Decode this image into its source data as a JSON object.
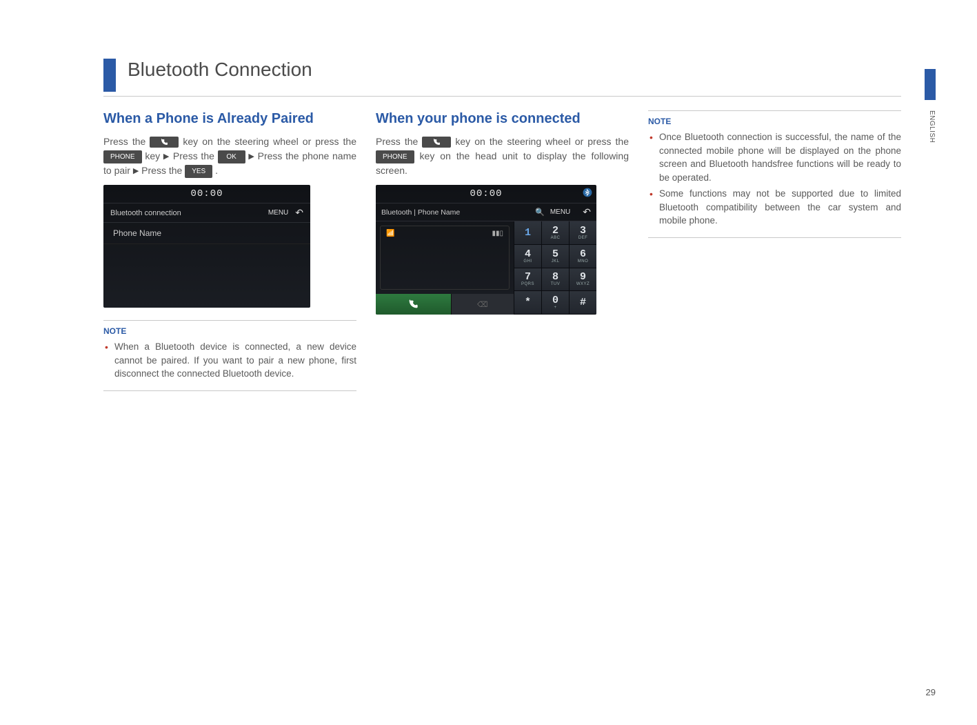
{
  "page": {
    "number": "29",
    "language_tab": "ENGLISH",
    "chapter_title": "Bluetooth Connection"
  },
  "col1": {
    "heading": "When a Phone is Already Paired",
    "p1_a": "Press the ",
    "p1_b": " key on the steering wheel or press the ",
    "p1_c": " key ",
    "p1_d": " Press the ",
    "p1_e": " Press the phone name to pair ",
    "p1_f": " Press the ",
    "p1_g": ".",
    "kbd_phone": "PHONE",
    "kbd_ok": "OK",
    "kbd_yes": "YES",
    "note_label": "NOTE",
    "note_items": [
      "When a Bluetooth device is connected, a new device cannot be paired. If you want to pair a new phone, first disconnect the connected Bluetooth device."
    ],
    "shot": {
      "time": "00:00",
      "bar_title": "Bluetooth connection",
      "bar_menu": "MENU",
      "row1": "Phone Name"
    }
  },
  "col2": {
    "heading": "When your phone is connected",
    "p1_a": "Press the ",
    "p1_b": " key on the steering wheel or press the ",
    "p1_c": " key on the head unit to display the following screen.",
    "kbd_phone": "PHONE",
    "shot": {
      "time": "00:00",
      "bar_label": "Bluetooth | Phone Name",
      "bar_menu": "MENU",
      "keypad": [
        {
          "n": "1",
          "s": ""
        },
        {
          "n": "2",
          "s": "ABC"
        },
        {
          "n": "3",
          "s": "DEF"
        },
        {
          "n": "4",
          "s": "GHI"
        },
        {
          "n": "5",
          "s": "JKL"
        },
        {
          "n": "6",
          "s": "MNO"
        },
        {
          "n": "7",
          "s": "PQRS"
        },
        {
          "n": "8",
          "s": "TUV"
        },
        {
          "n": "9",
          "s": "WXYZ"
        },
        {
          "n": "*",
          "s": ""
        },
        {
          "n": "0",
          "s": "+"
        },
        {
          "n": "#",
          "s": ""
        }
      ]
    }
  },
  "col3": {
    "note_label": "NOTE",
    "note_items": [
      "Once Bluetooth connection is successful, the name of the connected mobile phone will be displayed on the phone screen and Bluetooth handsfree functions will be ready to be operated.",
      "Some functions may not be supported due to limited Bluetooth compatibility between the car system and mobile phone."
    ]
  }
}
